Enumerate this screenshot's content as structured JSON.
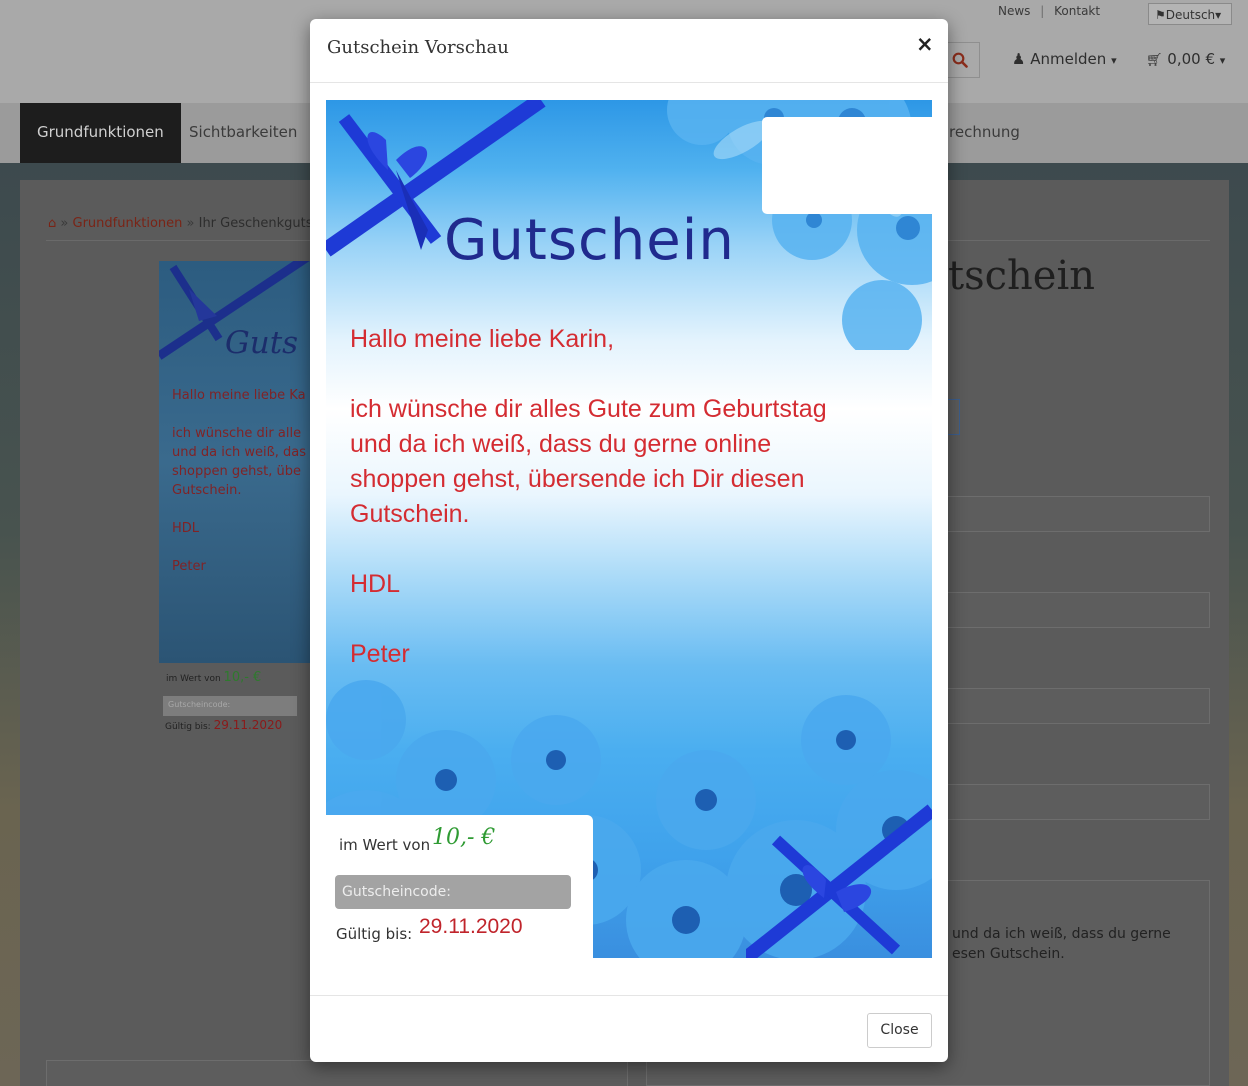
{
  "header": {
    "top_links": [
      "News",
      "Kontakt"
    ],
    "language": "Deutsch",
    "login_label": "Anmelden",
    "cart_label": "0,00 €"
  },
  "nav": {
    "items": [
      "Grundfunktionen",
      "Sichtbarkeiten",
      "rechnung"
    ]
  },
  "breadcrumb": {
    "link": "Grundfunktionen",
    "current": "Ihr Geschenkguts"
  },
  "background": {
    "heading": "tschein",
    "textarea_text": "und da ich weiß, dass du gerne\nesen Gutschein.",
    "thumbnail": {
      "title": "Guts",
      "lines": [
        "Hallo meine liebe Ka",
        "",
        "ich wünsche dir alle",
        "und da ich weiß, das",
        "shoppen gehst, übe",
        "Gutschein.",
        "",
        "HDL",
        "",
        "Peter"
      ],
      "wert_label": "im Wert von",
      "wert_value": "10,- €",
      "code_label": "Gutscheincode:",
      "valid_label": "Gültig bis:",
      "valid_value": "29.11.2020"
    }
  },
  "modal": {
    "title": "Gutschein Vorschau",
    "close_x": "×",
    "close_button": "Close",
    "voucher": {
      "title": "Gutschein",
      "greeting": "Hallo meine liebe Karin,",
      "body_lines": [
        "ich wünsche dir alles Gute zum Geburtstag",
        "und da ich weiß, dass du gerne online",
        "shoppen gehst, übersende ich Dir diesen",
        "Gutschein."
      ],
      "closing": "HDL",
      "signature": "Peter",
      "wert_label": "im Wert von",
      "wert_value": "10,- €",
      "code_label": "Gutscheincode:",
      "valid_label": "Gültig bis:",
      "valid_value": "29.11.2020"
    }
  },
  "colors": {
    "voucher_text_red": "#d42c32",
    "voucher_title_blue": "#202a8e",
    "value_green": "#2f9b33",
    "ribbon_blue": "#1e3ad6"
  },
  "icons": [
    "home-icon",
    "user-icon",
    "cart-icon",
    "search-icon",
    "close-icon",
    "caret-down-icon",
    "flag-icon"
  ]
}
